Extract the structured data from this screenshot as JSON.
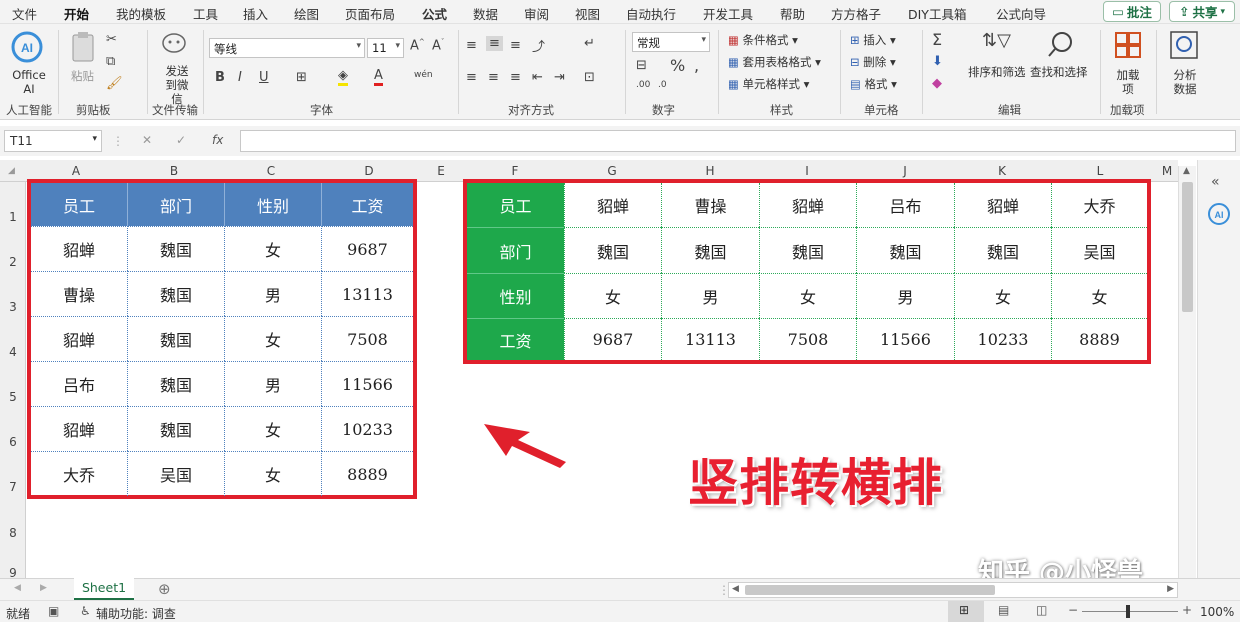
{
  "menu": {
    "items": [
      "文件",
      "开始",
      "我的模板",
      "工具",
      "插入",
      "绘图",
      "页面布局",
      "公式",
      "数据",
      "审阅",
      "视图",
      "自动执行",
      "开发工具",
      "帮助",
      "方方格子",
      "DIY工具箱",
      "公式向导"
    ],
    "active_index": 1,
    "comment_button": "批注",
    "share_button": "共享"
  },
  "ribbon": {
    "office_ai": "Office AI",
    "paste": "粘贴",
    "send_wechat": "发送到微信",
    "font_name": "等线",
    "font_size": "11",
    "number_format": "常规",
    "conditional_format": "条件格式",
    "table_format": "套用表格格式",
    "cell_style": "单元格样式",
    "insert": "插入",
    "delete": "删除",
    "format": "格式",
    "sort_filter": "排序和筛选",
    "find_select": "查找和选择",
    "addins": "加载项",
    "analyze": "分析数据",
    "groups": [
      "人工智能",
      "剪贴板",
      "文件传输",
      "字体",
      "对齐方式",
      "数字",
      "样式",
      "单元格",
      "编辑",
      "加载项"
    ]
  },
  "formula_bar": {
    "name_box": "T11",
    "fx": "fx",
    "content": ""
  },
  "columns": [
    "A",
    "B",
    "C",
    "D",
    "E",
    "F",
    "G",
    "H",
    "I",
    "J",
    "K",
    "L",
    "M"
  ],
  "rows": [
    "1",
    "2",
    "3",
    "4",
    "5",
    "6",
    "7",
    "8",
    "9"
  ],
  "table_vertical": {
    "headers": [
      "员工",
      "部门",
      "性别",
      "工资"
    ],
    "rows": [
      [
        "貂蝉",
        "魏国",
        "女",
        "9687"
      ],
      [
        "曹操",
        "魏国",
        "男",
        "13113"
      ],
      [
        "貂蝉",
        "魏国",
        "女",
        "7508"
      ],
      [
        "吕布",
        "魏国",
        "男",
        "11566"
      ],
      [
        "貂蝉",
        "魏国",
        "女",
        "10233"
      ],
      [
        "大乔",
        "吴国",
        "女",
        "8889"
      ]
    ],
    "header_color": "#4f81bd"
  },
  "table_horizontal": {
    "row_headers": [
      "员工",
      "部门",
      "性别",
      "工资"
    ],
    "rows": [
      [
        "貂蝉",
        "曹操",
        "貂蝉",
        "吕布",
        "貂蝉",
        "大乔"
      ],
      [
        "魏国",
        "魏国",
        "魏国",
        "魏国",
        "魏国",
        "吴国"
      ],
      [
        "女",
        "男",
        "女",
        "男",
        "女",
        "女"
      ],
      [
        "9687",
        "13113",
        "7508",
        "11566",
        "10233",
        "8889"
      ]
    ],
    "header_color": "#1ea84b"
  },
  "annotation": {
    "caption": "竖排转横排",
    "watermark": "知乎 @小怪兽"
  },
  "sheet_tab": "Sheet1",
  "status": {
    "ready": "就绪",
    "accessibility": "辅助功能: 调查",
    "zoom": "100%"
  },
  "colors": {
    "border_red": "#e0202c",
    "accent_green": "#1e7145"
  }
}
